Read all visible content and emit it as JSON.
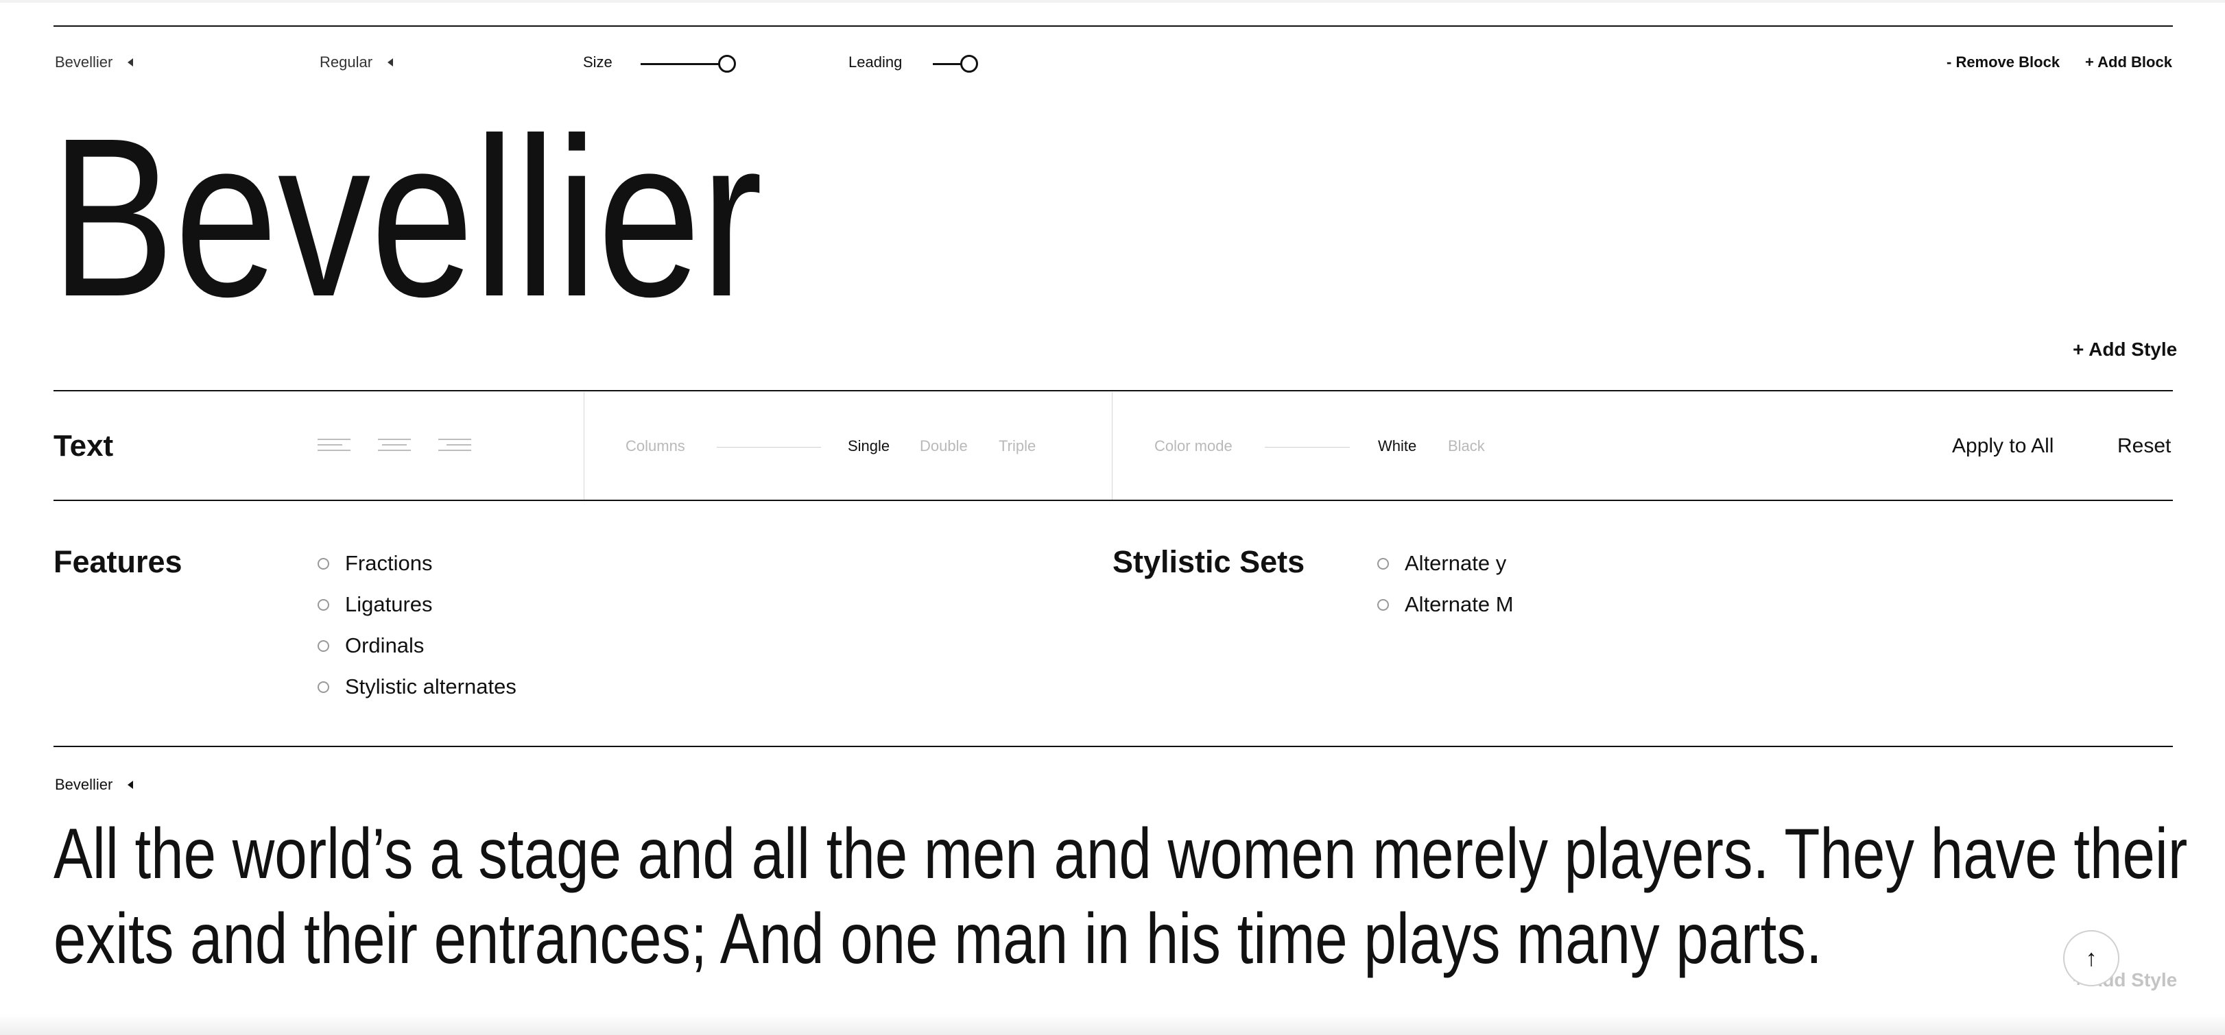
{
  "toolbar": {
    "font_name": "Bevellier",
    "weight": "Regular",
    "size_label": "Size",
    "leading_label": "Leading",
    "remove_block": "- Remove Block",
    "add_block": "+ Add Block",
    "size_value": 1.0,
    "leading_value": 1.0
  },
  "specimen": {
    "text": "Bevellier",
    "add_style": "+ Add Style"
  },
  "text_settings": {
    "title": "Text",
    "align_icons": [
      "align-left-icon",
      "align-center-icon",
      "align-right-icon"
    ],
    "columns_label": "Columns",
    "columns_options": [
      "Single",
      "Double",
      "Triple"
    ],
    "columns_selected": "Single",
    "color_mode_label": "Color mode",
    "color_mode_options": [
      "White",
      "Black"
    ],
    "color_mode_selected": "White",
    "apply_all": "Apply to All",
    "reset": "Reset"
  },
  "features": {
    "title": "Features",
    "items": [
      "Fractions",
      "Ligatures",
      "Ordinals",
      "Stylistic alternates"
    ]
  },
  "stylistic_sets": {
    "title": "Stylistic Sets",
    "items": [
      "Alternate y",
      "Alternate M"
    ]
  },
  "block2": {
    "font_name": "Bevellier",
    "line1": "All the world’s a stage and all the men and women merely players. They have their",
    "line2": "exits and their entrances; And one man in his time plays many parts.",
    "add_style": "+ Add Style"
  },
  "scroll_top_icon": "arrow-up-icon"
}
